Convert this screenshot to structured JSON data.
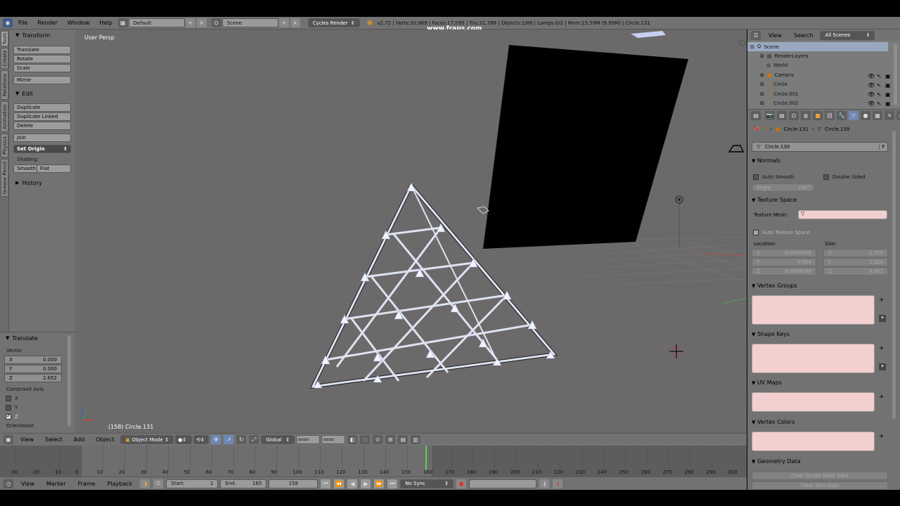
{
  "info_header": {
    "menus": [
      "File",
      "Render",
      "Window",
      "Help"
    ],
    "screen_layout": "Default",
    "scene": "Scene",
    "render_engine": "Cycles Render",
    "stats": "v2.72 | Verts:30,969 | Faces:17,095 | Tris:31,788 | Objects:1/86 | Lamps:0/2 | Mem:15.59M (9.99M) | Circle.131",
    "watermark": "www.fraps.com"
  },
  "tool_tabs": [
    "Tools",
    "Create",
    "Relations",
    "Animation",
    "Physics",
    "Grease Pencil"
  ],
  "tool_shelf": {
    "transform_title": "Transform",
    "transform_buttons": [
      "Translate",
      "Rotate",
      "Scale"
    ],
    "mirror": "Mirror",
    "edit_title": "Edit",
    "edit_buttons": [
      "Duplicate",
      "Duplicate Linked",
      "Delete"
    ],
    "join": "Join",
    "set_origin": "Set Origin",
    "shading_label": "Shading:",
    "smooth": "Smooth",
    "flat": "Flat",
    "history": "History"
  },
  "redo_panel": {
    "title": "Translate",
    "vector_label": "Vector",
    "fields": [
      {
        "axis": "X",
        "value": "0.000"
      },
      {
        "axis": "Y",
        "value": "0.000"
      },
      {
        "axis": "Z",
        "value": "2.652"
      }
    ],
    "constraint_label": "Constraint Axis",
    "constraints": [
      {
        "axis": "X",
        "checked": false
      },
      {
        "axis": "Y",
        "checked": false
      },
      {
        "axis": "Z",
        "checked": true
      }
    ],
    "orientation_label": "Orientation"
  },
  "viewport": {
    "view_name": "User Persp",
    "object_info": "(158) Circle.131"
  },
  "view3d_header": {
    "menus": [
      "View",
      "Select",
      "Add",
      "Object"
    ],
    "mode": "Object Mode",
    "orientation": "Global"
  },
  "timeline": {
    "ticks": [
      "-30",
      "-20",
      "-10",
      "0",
      "10",
      "20",
      "30",
      "40",
      "50",
      "60",
      "70",
      "80",
      "90",
      "100",
      "110",
      "120",
      "130",
      "140",
      "150",
      "160",
      "170",
      "180",
      "190",
      "200",
      "210",
      "220",
      "230",
      "240",
      "250",
      "260",
      "270",
      "280",
      "290",
      "300"
    ],
    "menus": [
      "View",
      "Marker",
      "Frame",
      "Playback"
    ],
    "start_label": "Start:",
    "start_value": "1",
    "end_label": "End:",
    "end_value": "165",
    "current_frame": "158",
    "sync": "No Sync"
  },
  "outliner": {
    "menus": [
      "View",
      "Search"
    ],
    "filter": "All Scenes",
    "items": [
      "Scene",
      "RenderLayers",
      "World",
      "Camera",
      "Circle",
      "Circle.001",
      "Circle.002"
    ]
  },
  "properties": {
    "breadcrumb_object": "Circle.131",
    "breadcrumb_mesh": "Circle.139",
    "mesh_name": "Circle.139",
    "fake_user": "F",
    "normals_title": "Normals",
    "auto_smooth": "Auto Smooth",
    "double_sided": "Double Sided",
    "angle_label": "Angle:",
    "angle_value": "180°",
    "texture_space_title": "Texture Space",
    "texture_mesh_label": "Texture Mesh:",
    "auto_texture_space": "Auto Texture Space",
    "location_label": "Location:",
    "size_label": "Size:",
    "location": [
      {
        "axis": "X",
        "value": "-0.0000006"
      },
      {
        "axis": "Y",
        "value": "0.004"
      },
      {
        "axis": "Z",
        "value": "0.0004039"
      }
    ],
    "size": [
      {
        "axis": "X",
        "value": "1.750"
      },
      {
        "axis": "Y",
        "value": "2.020"
      },
      {
        "axis": "Z",
        "value": "0.002"
      }
    ],
    "vertex_groups_title": "Vertex Groups",
    "shape_keys_title": "Shape Keys",
    "uv_maps_title": "UV Maps",
    "vertex_colors_title": "Vertex Colors",
    "geometry_data_title": "Geometry Data",
    "clear_sculpt_mask": "Clear Sculpt-Mask Data",
    "clear_skin": "Clear Skin Data"
  }
}
